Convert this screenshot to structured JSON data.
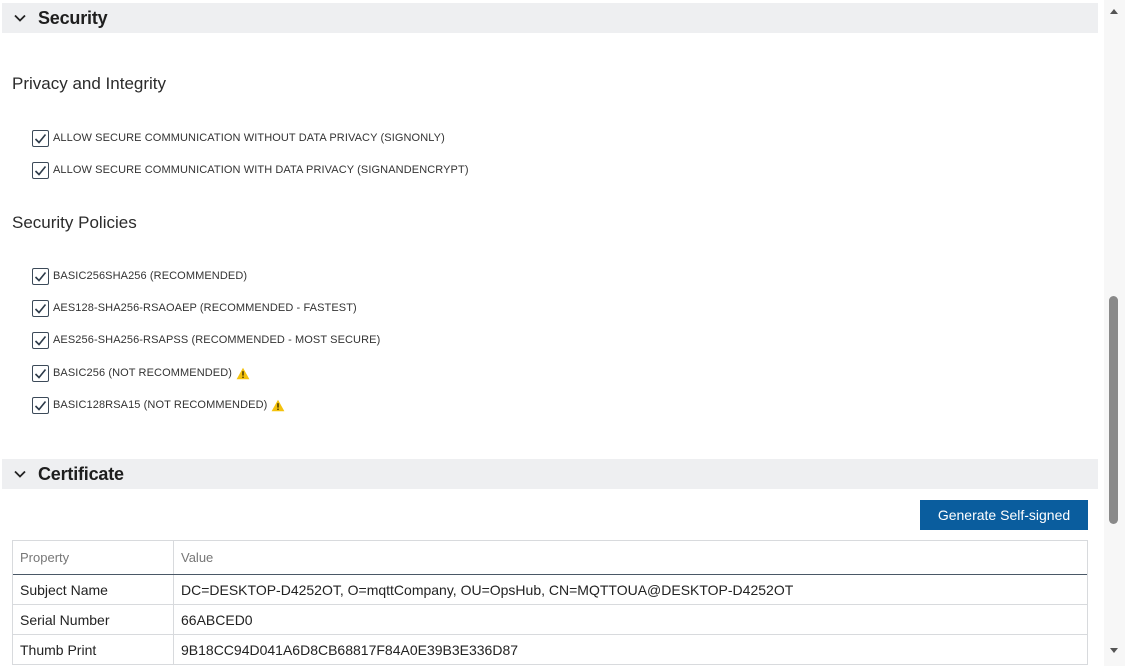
{
  "security": {
    "title": "Security",
    "privacy": {
      "heading": "Privacy and Integrity",
      "options": [
        {
          "label": "ALLOW SECURE COMMUNICATION WITHOUT DATA PRIVACY (SIGNONLY)",
          "checked": true
        },
        {
          "label": "ALLOW SECURE COMMUNICATION WITH DATA PRIVACY (SIGNANDENCRYPT)",
          "checked": true
        }
      ]
    },
    "policies": {
      "heading": "Security Policies",
      "options": [
        {
          "label": "BASIC256SHA256 (RECOMMENDED)",
          "checked": true,
          "warning": false
        },
        {
          "label": "AES128-SHA256-RSAOAEP (RECOMMENDED - FASTEST)",
          "checked": true,
          "warning": false
        },
        {
          "label": "AES256-SHA256-RSAPSS (RECOMMENDED - MOST SECURE)",
          "checked": true,
          "warning": false
        },
        {
          "label": "BASIC256 (NOT RECOMMENDED)",
          "checked": true,
          "warning": true
        },
        {
          "label": "BASIC128RSA15 (NOT RECOMMENDED)",
          "checked": true,
          "warning": true
        }
      ]
    }
  },
  "certificate": {
    "title": "Certificate",
    "generate_button": "Generate Self-signed",
    "table": {
      "columns": [
        "Property",
        "Value"
      ],
      "rows": [
        {
          "property": "Subject Name",
          "value": "DC=DESKTOP-D4252OT, O=mqttCompany, OU=OpsHub, CN=MQTTOUA@DESKTOP-D4252OT"
        },
        {
          "property": "Serial Number",
          "value": "66ABCED0"
        },
        {
          "property": "Thumb Print",
          "value": "9B18CC94D041A6D8CB68817F84A0E39B3E336D87"
        }
      ]
    }
  },
  "colors": {
    "header_bg": "#eeeff1",
    "primary_button": "#0a5d9e",
    "warning": "#f4c20d",
    "checkbox_border": "#3c4a59"
  },
  "icons": {
    "collapse": "chevron-down-icon",
    "checked": "checkmark-icon",
    "warning": "warning-triangle-icon"
  }
}
